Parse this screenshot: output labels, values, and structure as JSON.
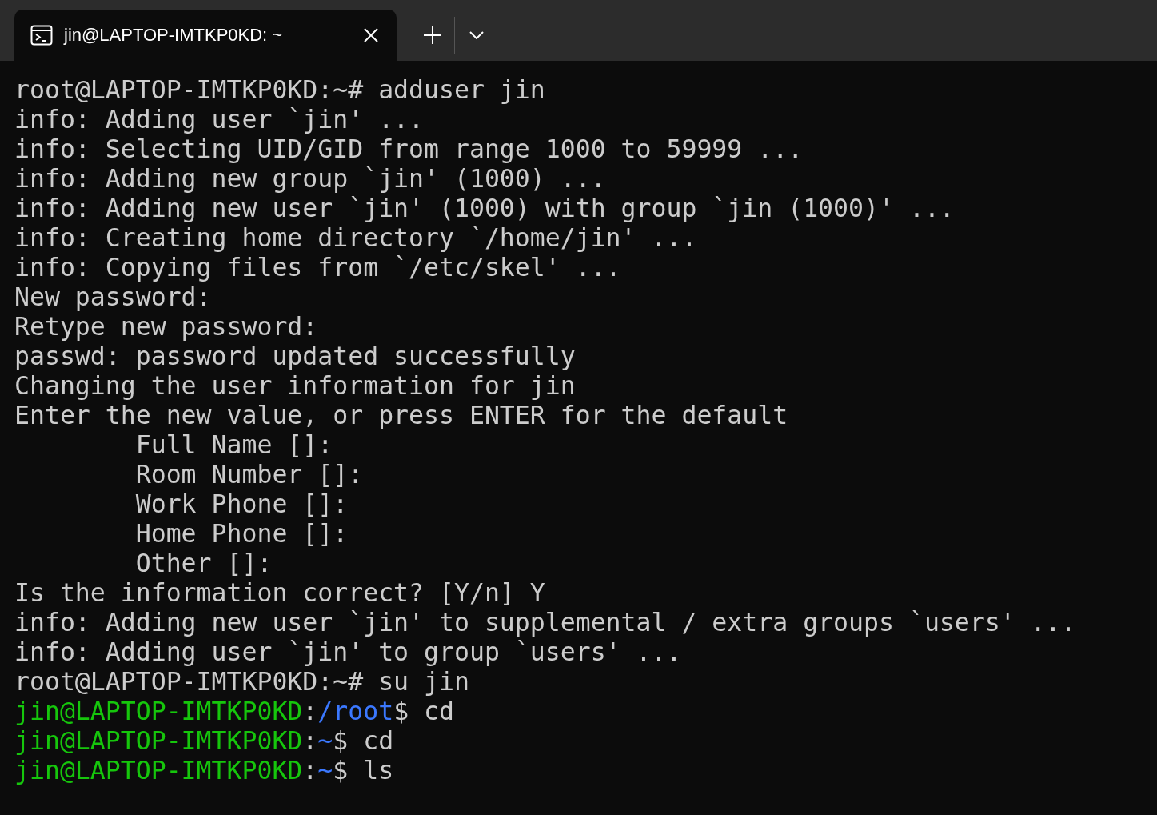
{
  "tabs": [
    {
      "title": "jin@LAPTOP-IMTKP0KD: ~",
      "selected": true
    }
  ],
  "terminal": {
    "lines": [
      [
        {
          "kind": "text",
          "text": "root@LAPTOP-IMTKP0KD:~# adduser jin"
        }
      ],
      [
        {
          "kind": "text",
          "text": "info: Adding user `jin' ..."
        }
      ],
      [
        {
          "kind": "text",
          "text": "info: Selecting UID/GID from range 1000 to 59999 ..."
        }
      ],
      [
        {
          "kind": "text",
          "text": "info: Adding new group `jin' (1000) ..."
        }
      ],
      [
        {
          "kind": "text",
          "text": "info: Adding new user `jin' (1000) with group `jin (1000)' ..."
        }
      ],
      [
        {
          "kind": "text",
          "text": "info: Creating home directory `/home/jin' ..."
        }
      ],
      [
        {
          "kind": "text",
          "text": "info: Copying files from `/etc/skel' ..."
        }
      ],
      [
        {
          "kind": "text",
          "text": "New password:"
        }
      ],
      [
        {
          "kind": "text",
          "text": "Retype new password:"
        }
      ],
      [
        {
          "kind": "text",
          "text": "passwd: password updated successfully"
        }
      ],
      [
        {
          "kind": "text",
          "text": "Changing the user information for jin"
        }
      ],
      [
        {
          "kind": "text",
          "text": "Enter the new value, or press ENTER for the default"
        }
      ],
      [
        {
          "kind": "text",
          "text": "        Full Name []:"
        }
      ],
      [
        {
          "kind": "text",
          "text": "        Room Number []:"
        }
      ],
      [
        {
          "kind": "text",
          "text": "        Work Phone []:"
        }
      ],
      [
        {
          "kind": "text",
          "text": "        Home Phone []:"
        }
      ],
      [
        {
          "kind": "text",
          "text": "        Other []:"
        }
      ],
      [
        {
          "kind": "text",
          "text": "Is the information correct? [Y/n] Y"
        }
      ],
      [
        {
          "kind": "text",
          "text": "info: Adding new user `jin' to supplemental / extra groups `users' ..."
        }
      ],
      [
        {
          "kind": "text",
          "text": "info: Adding user `jin' to group `users' ..."
        }
      ],
      [
        {
          "kind": "text",
          "text": "root@LAPTOP-IMTKP0KD:~# su jin"
        }
      ],
      [
        {
          "kind": "user",
          "text": "jin@LAPTOP-IMTKP0KD"
        },
        {
          "kind": "text",
          "text": ":"
        },
        {
          "kind": "path",
          "text": "/root"
        },
        {
          "kind": "text",
          "text": "$ cd"
        }
      ],
      [
        {
          "kind": "user",
          "text": "jin@LAPTOP-IMTKP0KD"
        },
        {
          "kind": "text",
          "text": ":"
        },
        {
          "kind": "path",
          "text": "~"
        },
        {
          "kind": "text",
          "text": "$ cd"
        }
      ],
      [
        {
          "kind": "user",
          "text": "jin@LAPTOP-IMTKP0KD"
        },
        {
          "kind": "text",
          "text": ":"
        },
        {
          "kind": "path",
          "text": "~"
        },
        {
          "kind": "text",
          "text": "$ ls"
        }
      ]
    ]
  }
}
